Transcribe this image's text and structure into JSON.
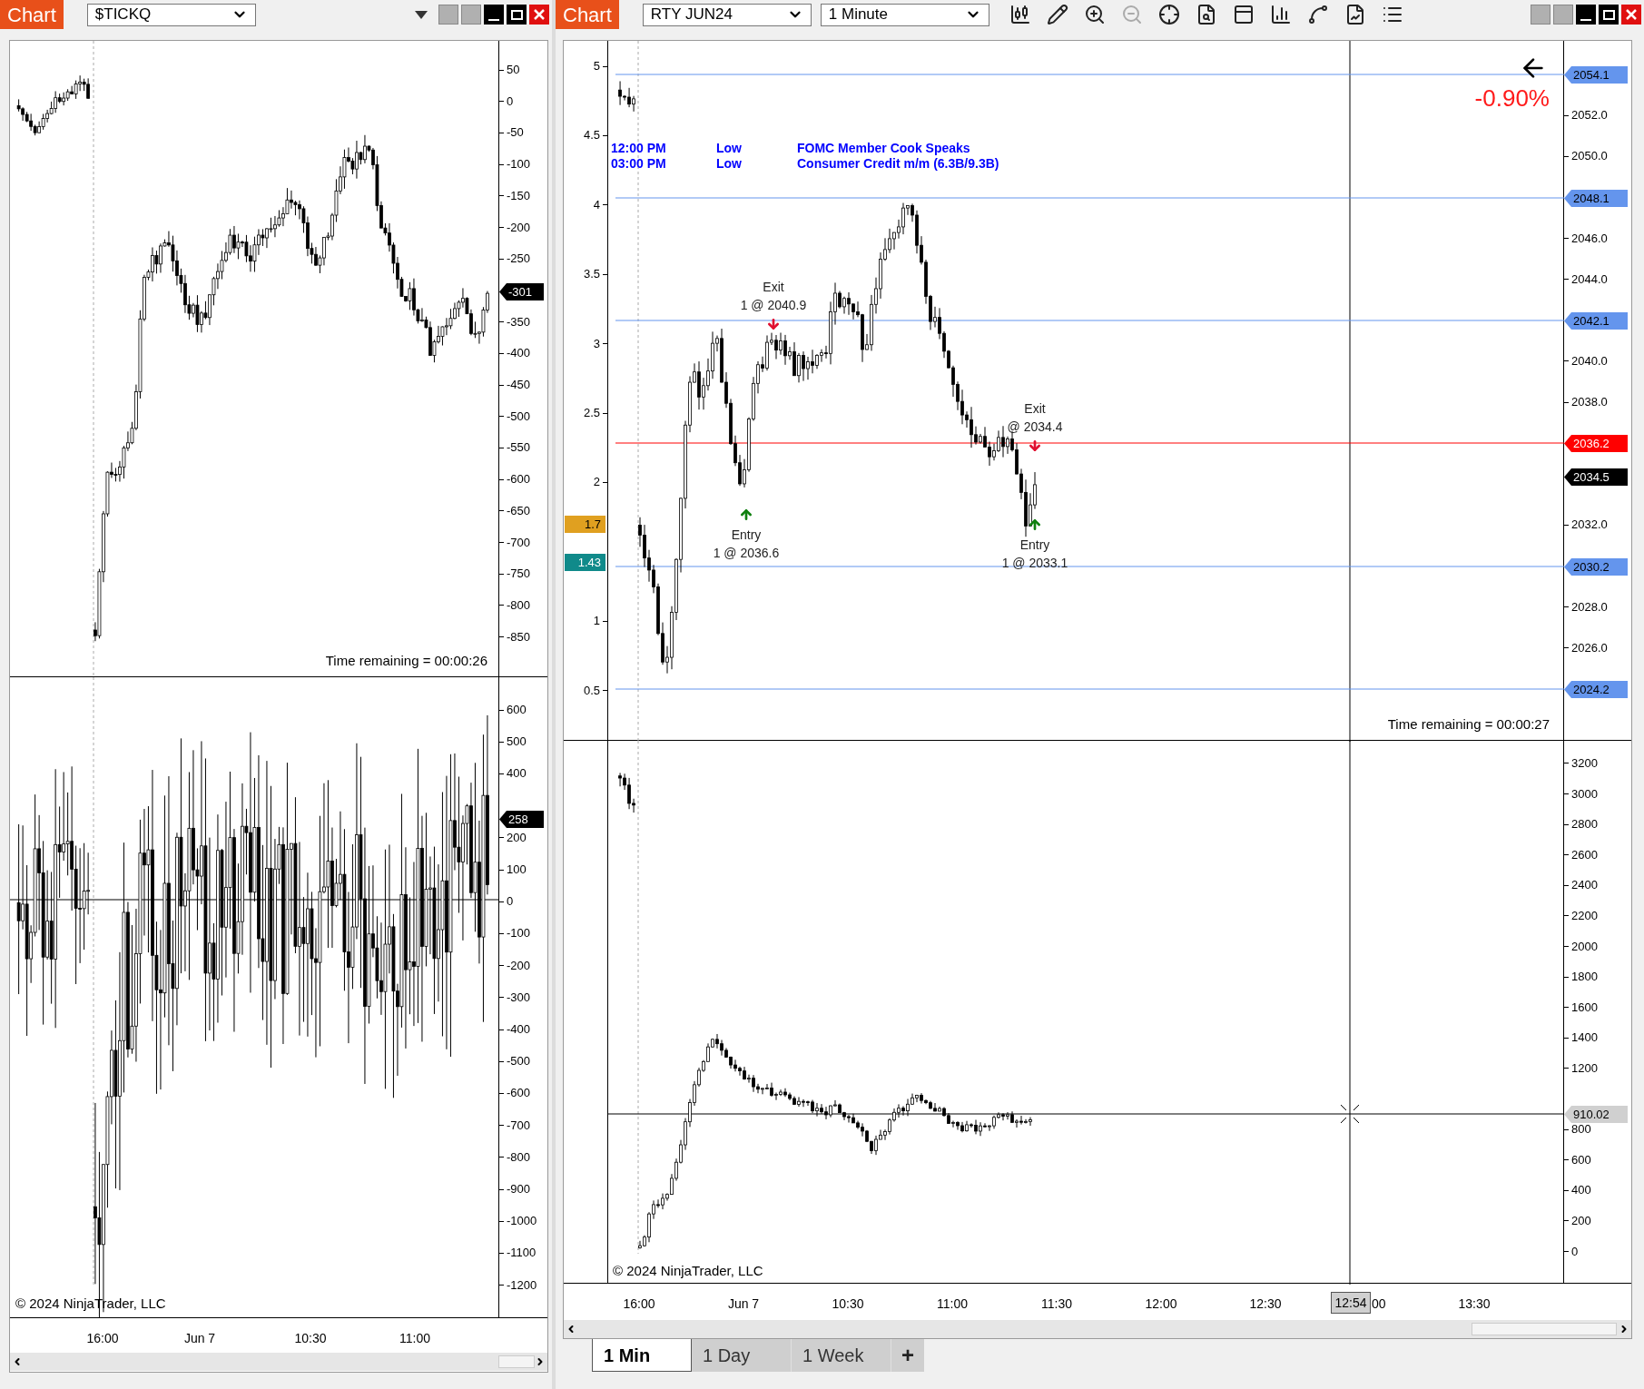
{
  "left_chart": {
    "title": "Chart",
    "instrument": "$TICKQ",
    "upper_pane": {
      "axis_labels": [
        "50",
        "0",
        "-50",
        "-100",
        "-150",
        "-200",
        "-250",
        "-350",
        "-400",
        "-450",
        "-500",
        "-550",
        "-600",
        "-650",
        "-700",
        "-750",
        "-800",
        "-850"
      ],
      "last_value": "-301",
      "time_remaining": "Time remaining = 00:00:26"
    },
    "lower_pane": {
      "axis_labels": [
        "600",
        "500",
        "400",
        "200",
        "100",
        "0",
        "-100",
        "-200",
        "-300",
        "-400",
        "-500",
        "-600",
        "-700",
        "-800",
        "-900",
        "-1000",
        "-1100",
        "-1200"
      ],
      "last_value": "258",
      "copyright": "© 2024 NinjaTrader, LLC"
    },
    "time_axis": [
      "16:00",
      "Jun 7",
      "10:30",
      "11:00"
    ]
  },
  "right_chart": {
    "title": "Chart",
    "instrument": "RTY JUN24",
    "interval": "1 Minute",
    "upper_pane": {
      "indicator_axis": [
        "5",
        "4.5",
        "4",
        "3.5",
        "3",
        "2.5",
        "2",
        "1",
        "0.5"
      ],
      "indicator_markers": [
        {
          "label": "1.7",
          "color": "#e0a020"
        },
        {
          "label": "1.43",
          "color": "#108a8a"
        }
      ],
      "price_axis": [
        "2052.0",
        "2050.0",
        "2046.0",
        "2044.0",
        "2040.0",
        "2038.0",
        "2032.0",
        "2028.0",
        "2026.0"
      ],
      "price_markers": [
        {
          "kind": "line",
          "label": "2054.1",
          "color": "#6495ed"
        },
        {
          "kind": "line",
          "label": "2048.1",
          "color": "#6495ed"
        },
        {
          "kind": "line",
          "label": "2042.1",
          "color": "#6495ed"
        },
        {
          "kind": "line",
          "label": "2036.2",
          "color": "#ff0000"
        },
        {
          "kind": "last",
          "label": "2034.5",
          "color": "#000000"
        },
        {
          "kind": "line",
          "label": "2030.2",
          "color": "#6495ed"
        },
        {
          "kind": "line",
          "label": "2024.2",
          "color": "#6495ed"
        }
      ],
      "change": "-0.90%",
      "events": [
        {
          "time": "12:00 PM",
          "impact": "Low",
          "name": "FOMC Member Cook Speaks"
        },
        {
          "time": "03:00 PM",
          "impact": "Low",
          "name": "Consumer Credit m/m (6.3B/9.3B)"
        }
      ],
      "trades": [
        {
          "kind": "exit",
          "label": "Exit",
          "fill": "1 @ 2040.9"
        },
        {
          "kind": "entry",
          "label": "Entry",
          "fill": "1 @ 2036.6"
        },
        {
          "kind": "exit",
          "label": "Exit",
          "fill": "@ 2034.4"
        },
        {
          "kind": "entry",
          "label": "Entry",
          "fill": "1 @ 2033.1"
        }
      ],
      "time_remaining": "Time remaining = 00:00:27"
    },
    "lower_pane": {
      "axis_labels": [
        "3200",
        "3000",
        "2800",
        "2600",
        "2400",
        "2200",
        "2000",
        "1800",
        "1600",
        "1400",
        "1200",
        "800",
        "600",
        "400",
        "200",
        "0"
      ],
      "crosshair_value": "910.02",
      "copyright": "© 2024 NinjaTrader, LLC"
    },
    "time_axis": {
      "labels": [
        "16:00",
        "Jun 7",
        "10:30",
        "11:00",
        "11:30",
        "12:00",
        "12:30",
        "00",
        "13:30"
      ],
      "crosshair_time": "12:54"
    },
    "tabs": [
      {
        "label": "1 Min",
        "selected": true
      },
      {
        "label": "1 Day",
        "selected": false
      },
      {
        "label": "1 Week",
        "selected": false
      }
    ],
    "add_tab": "+"
  }
}
